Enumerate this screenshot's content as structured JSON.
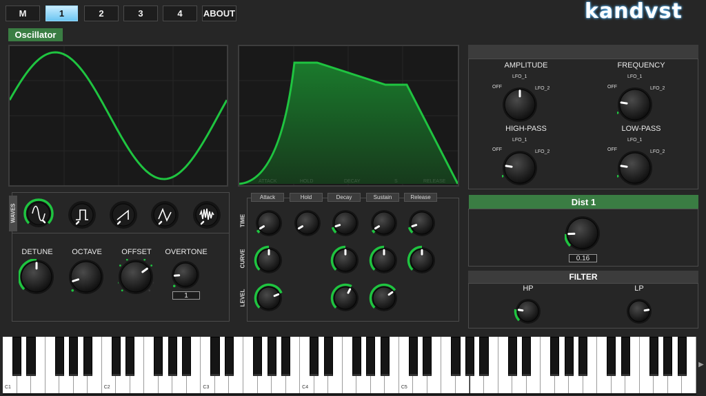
{
  "tabs": [
    {
      "label": "M",
      "active": false
    },
    {
      "label": "1",
      "active": true
    },
    {
      "label": "2",
      "active": false
    },
    {
      "label": "3",
      "active": false
    },
    {
      "label": "4",
      "active": false
    },
    {
      "label": "ABOUT",
      "active": false
    }
  ],
  "logo": "kandvst",
  "oscillator": {
    "title": "Oscillator",
    "waves_label": "WAVES",
    "waves": [
      "sine",
      "square",
      "saw",
      "triangle",
      "noise"
    ],
    "selected_wave": "sine",
    "knobs": {
      "detune": {
        "label": "DETUNE",
        "value": 0.5
      },
      "octave": {
        "label": "OCTAVE",
        "value": 0.1
      },
      "offset": {
        "label": "OFFSET",
        "value": 0.7
      },
      "overtone": {
        "label": "OVERTONE",
        "value": 0.15,
        "display": "1"
      }
    }
  },
  "envelope": {
    "screen_labels": [
      "ATTACK",
      "HOLD",
      "DECAY",
      "S",
      "RELEASE"
    ],
    "columns": [
      "Attack",
      "Hold",
      "Decay",
      "Sustain",
      "Release"
    ],
    "rows": [
      "TIME",
      "CURVE",
      "LEVEL"
    ]
  },
  "modulation": {
    "knobs": [
      {
        "label": "AMPLITUDE",
        "off": "OFF",
        "lfo1": "LFO_1",
        "lfo2": "LFO_2"
      },
      {
        "label": "FREQUENCY",
        "off": "OFF",
        "lfo1": "LFO_1",
        "lfo2": "LFO_2"
      },
      {
        "label": "HIGH-PASS",
        "off": "OFF",
        "lfo1": "LFO_1",
        "lfo2": "LFO_2"
      },
      {
        "label": "LOW-PASS",
        "off": "OFF",
        "lfo1": "LFO_1",
        "lfo2": "LFO_2"
      }
    ]
  },
  "dist": {
    "title": "Dist 1",
    "value": "0.16"
  },
  "filter": {
    "title": "FILTER",
    "hp": "HP",
    "lp": "LP"
  },
  "keyboard": {
    "labels": [
      "C1",
      "C2",
      "C3",
      "C4",
      "C5"
    ],
    "scroll_icon": "play-arrow-icon",
    "arrow": "▶"
  },
  "colors": {
    "accent": "#1fc440",
    "panel_label": "#3a7d43",
    "tab_active": "#8fd6ff"
  }
}
